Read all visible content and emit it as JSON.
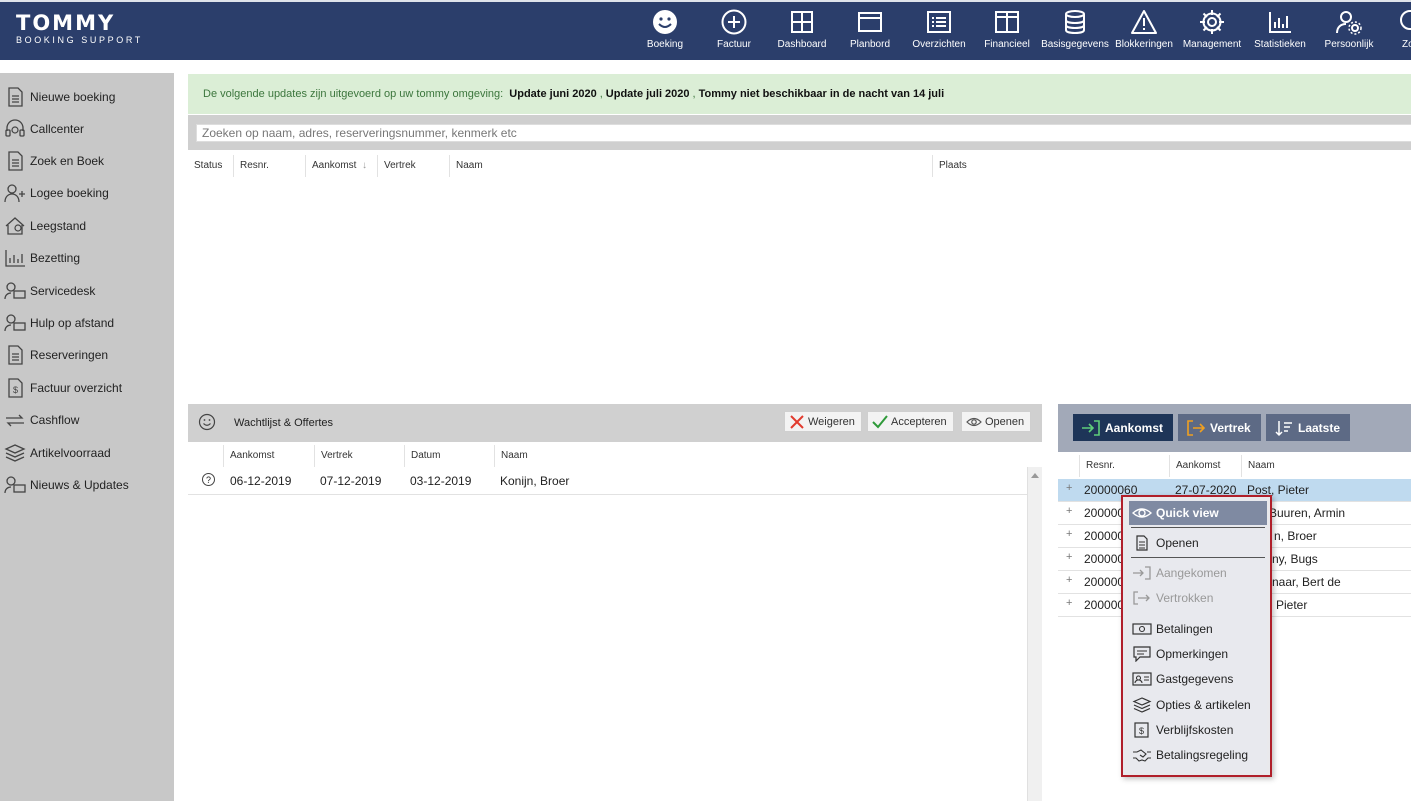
{
  "brand": {
    "title": "TOMMY",
    "subtitle": "BOOKING SUPPORT"
  },
  "topnav": [
    {
      "label": "Boeking",
      "icon": "smiley-icon"
    },
    {
      "label": "Factuur",
      "icon": "plus-circle-icon"
    },
    {
      "label": "Dashboard",
      "icon": "grid-icon"
    },
    {
      "label": "Planbord",
      "icon": "planbord-icon"
    },
    {
      "label": "Overzichten",
      "icon": "list-icon"
    },
    {
      "label": "Financieel",
      "icon": "columns-icon"
    },
    {
      "label": "Basisgegevens",
      "icon": "database-icon"
    },
    {
      "label": "Blokkeringen",
      "icon": "warning-icon"
    },
    {
      "label": "Management",
      "icon": "gear-icon"
    },
    {
      "label": "Statistieken",
      "icon": "bar-chart-icon"
    },
    {
      "label": "Persoonlijk",
      "icon": "user-gear-icon"
    },
    {
      "label": "Zo",
      "icon": "search-icon"
    }
  ],
  "sidebar": [
    {
      "label": "Nieuwe boeking",
      "icon": "document-icon"
    },
    {
      "label": "Callcenter",
      "icon": "headset-icon"
    },
    {
      "label": "Zoek en Boek",
      "icon": "document-icon"
    },
    {
      "label": "Logee boeking",
      "icon": "user-plus-icon"
    },
    {
      "label": "Leegstand",
      "icon": "house-icon"
    },
    {
      "label": "Bezetting",
      "icon": "bar-chart-icon"
    },
    {
      "label": "Servicedesk",
      "icon": "user-desk-icon"
    },
    {
      "label": "Hulp op afstand",
      "icon": "user-desk-icon"
    },
    {
      "label": "Reserveringen",
      "icon": "document-icon"
    },
    {
      "label": "Factuur overzicht",
      "icon": "invoice-icon"
    },
    {
      "label": "Cashflow",
      "icon": "arrows-icon"
    },
    {
      "label": "Artikelvoorraad",
      "icon": "layers-icon"
    },
    {
      "label": "Nieuws & Updates",
      "icon": "user-desk-icon"
    }
  ],
  "notice": {
    "prefix": "De volgende updates zijn uitgevoerd op uw tommy omgeving:",
    "items": [
      "Update juni 2020",
      ",",
      "Update juli 2020",
      ",",
      "Tommy niet beschikbaar in de nacht van 14 juli"
    ]
  },
  "search": {
    "placeholder": "Zoeken op naam, adres, reserveringsnummer, kenmerk etc"
  },
  "results_columns": [
    "Status",
    "Resnr.",
    "Aankomst",
    "Vertrek",
    "Naam",
    "Plaats"
  ],
  "waitlist": {
    "title": "Wachtlijst & Offertes",
    "buttons": {
      "reject": "Weigeren",
      "accept": "Accepteren",
      "open": "Openen"
    },
    "columns": [
      "Aankomst",
      "Vertrek",
      "Datum",
      "Naam"
    ],
    "rows": [
      {
        "status": "?",
        "aankomst": "06-12-2019",
        "vertrek": "07-12-2019",
        "datum": "03-12-2019",
        "naam": "Konijn, Broer"
      }
    ]
  },
  "arrivals": {
    "tabs": [
      "Aankomst",
      "Vertrek",
      "Laatste"
    ],
    "colors": {
      "aankomst": "#1e3558",
      "vertrek": "#5d6a85",
      "laatste": "#5d6a85",
      "vertrek_icon": "#f0a020"
    },
    "columns": [
      "Resnr.",
      "Aankomst",
      "Naam"
    ],
    "rows": [
      {
        "resnr": "20000060",
        "aankomst": "27-07-2020",
        "naam": "Post, Pieter",
        "selected": true
      },
      {
        "resnr": "200000",
        "aankomst": "",
        "naam": "Buuren, Armin"
      },
      {
        "resnr": "200000",
        "aankomst": "",
        "naam": "n, Broer"
      },
      {
        "resnr": "200000",
        "aankomst": "",
        "naam": "ny, Bugs"
      },
      {
        "resnr": "200000",
        "aankomst": "",
        "naam": "naar, Bert de"
      },
      {
        "resnr": "200000",
        "aankomst": "",
        "naam": "Pieter"
      }
    ]
  },
  "context_menu": {
    "items": [
      {
        "label": "Quick view",
        "icon": "eye-icon",
        "state": "active"
      },
      {
        "label": "Openen",
        "icon": "document-icon",
        "state": "normal"
      },
      {
        "label": "Aangekomen",
        "icon": "arrive-icon",
        "state": "disabled"
      },
      {
        "label": "Vertrokken",
        "icon": "depart-icon",
        "state": "disabled"
      },
      {
        "label": "Betalingen",
        "icon": "banknote-icon",
        "state": "normal"
      },
      {
        "label": "Opmerkingen",
        "icon": "comment-icon",
        "state": "normal"
      },
      {
        "label": "Gastgegevens",
        "icon": "id-card-icon",
        "state": "normal"
      },
      {
        "label": "Opties & artikelen",
        "icon": "layers-icon",
        "state": "normal"
      },
      {
        "label": "Verblijfskosten",
        "icon": "invoice-icon",
        "state": "normal"
      },
      {
        "label": "Betalingsregeling",
        "icon": "handshake-icon",
        "state": "normal"
      }
    ]
  }
}
